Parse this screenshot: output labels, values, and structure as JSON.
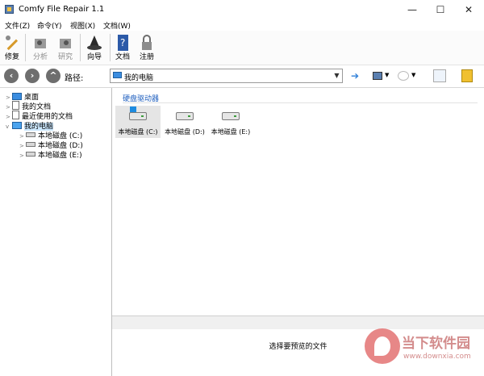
{
  "window": {
    "title": "Comfy File Repair 1.1",
    "controls": {
      "minimize": "—",
      "maximize": "☐",
      "close": "✕"
    }
  },
  "menu": [
    "文件(Z)",
    "命令(Y)",
    "视图(X)",
    "文档(W)"
  ],
  "toolbar": [
    {
      "label": "修复",
      "icon": "wrench-icon",
      "enabled": true
    },
    {
      "label": "分析",
      "icon": "analyze-icon",
      "enabled": false
    },
    {
      "label": "研究",
      "icon": "research-icon",
      "enabled": false
    },
    {
      "label": "向导",
      "icon": "wizard-icon",
      "enabled": true
    },
    {
      "label": "文档",
      "icon": "help-book-icon",
      "enabled": true
    },
    {
      "label": "注册",
      "icon": "lock-icon",
      "enabled": true
    }
  ],
  "address": {
    "label": "路径:",
    "value": "我的电脑"
  },
  "tree": {
    "items": [
      {
        "label": "桌面",
        "level": 0,
        "expander": ">",
        "icon": "desktop-icon"
      },
      {
        "label": "我的文档",
        "level": 0,
        "expander": ">",
        "icon": "documents-icon"
      },
      {
        "label": "最近使用的文档",
        "level": 0,
        "expander": ">",
        "icon": "recent-docs-icon"
      },
      {
        "label": "我的电脑",
        "level": 0,
        "expander": "v",
        "icon": "computer-icon",
        "selected": true
      },
      {
        "label": "本地磁盘 (C:)",
        "level": 1,
        "expander": ">",
        "icon": "system-drive-icon"
      },
      {
        "label": "本地磁盘 (D:)",
        "level": 1,
        "expander": ">",
        "icon": "drive-icon"
      },
      {
        "label": "本地磁盘 (E:)",
        "level": 1,
        "expander": ">",
        "icon": "drive-icon"
      }
    ]
  },
  "main": {
    "group_label": "硬盘驱动器",
    "drives": [
      {
        "label": "本地磁盘 (C:)",
        "system": true,
        "active": true
      },
      {
        "label": "本地磁盘 (D:)",
        "system": false,
        "active": false
      },
      {
        "label": "本地磁盘 (E:)",
        "system": false,
        "active": false
      }
    ]
  },
  "preview": {
    "text": "选择要预览的文件"
  },
  "watermark": {
    "name": "当下软件园",
    "url": "www.downxia.com"
  }
}
